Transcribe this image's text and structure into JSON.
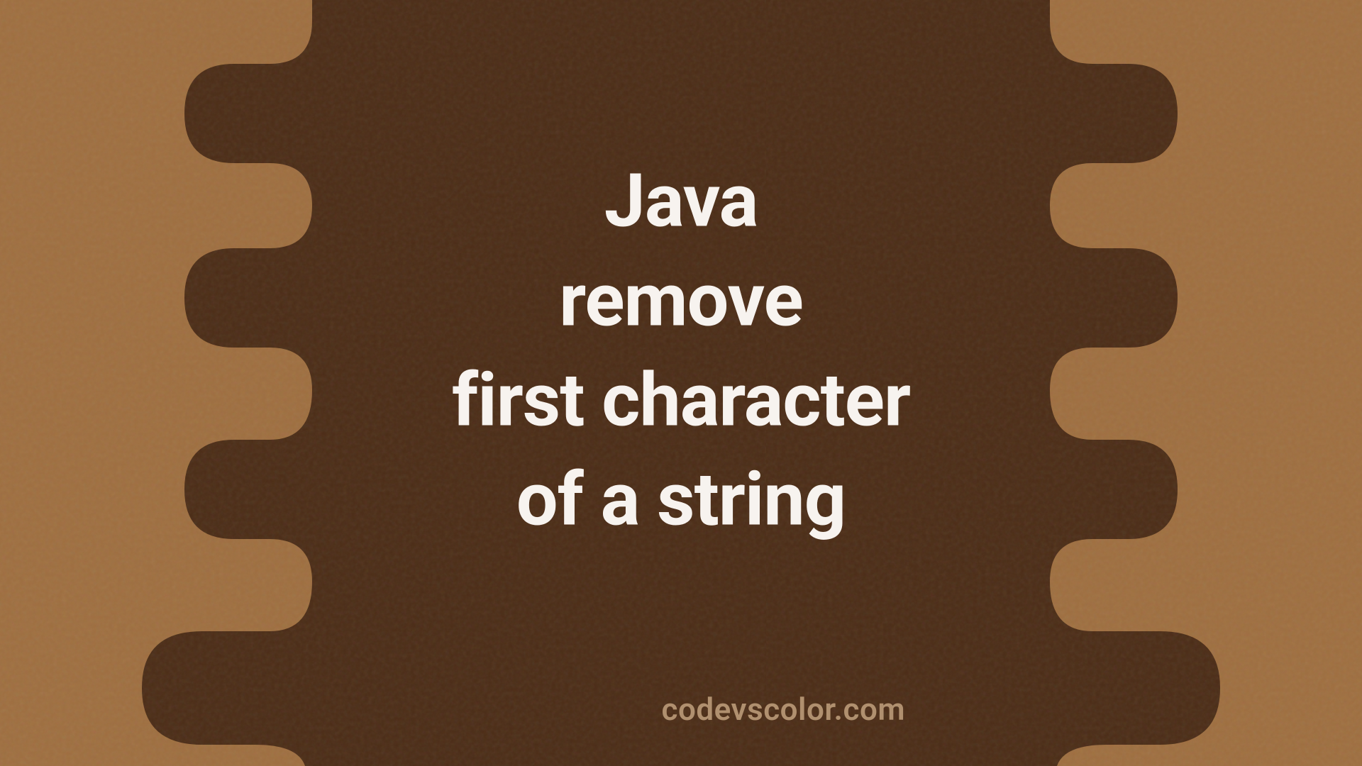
{
  "title": {
    "line1": "Java",
    "line2": "remove",
    "line3": "first character",
    "line4": "of a string"
  },
  "attribution": "codevscolor.com",
  "colors": {
    "background_light": "#9e6e3f",
    "shape_dark": "#4b2c16",
    "text_main": "#f7f3ef",
    "text_attribution": "#b0906f"
  }
}
